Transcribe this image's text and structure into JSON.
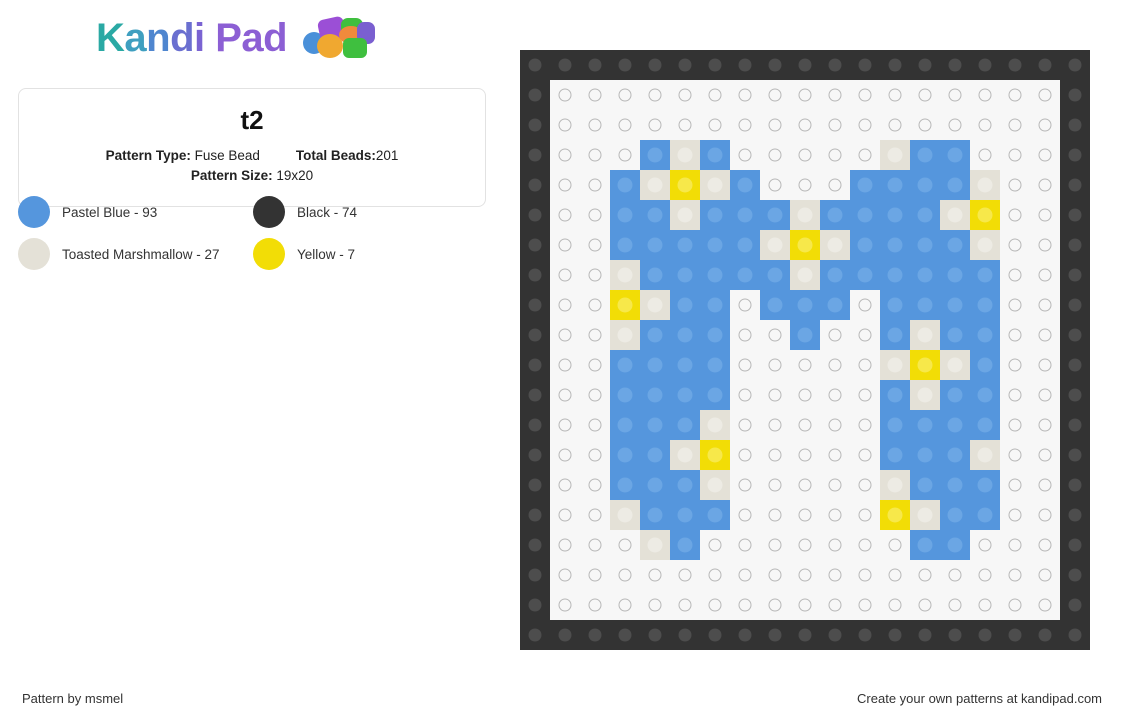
{
  "brand": {
    "name_parts": [
      "K",
      "a",
      "n",
      "d",
      "i",
      " Pad"
    ],
    "full_name": "Kandi Pad",
    "beads_icon": "kandi-beads-icon"
  },
  "pattern": {
    "title": "t2",
    "type_label": "Pattern Type:",
    "type_value": "Fuse Bead",
    "total_label": "Total Beads:",
    "total_value": "201",
    "size_label": "Pattern Size:",
    "size_value": "19x20"
  },
  "legend": [
    {
      "name": "Pastel Blue - 93",
      "color": "#5596dd",
      "swatch": "pastel-blue-swatch"
    },
    {
      "name": "Black - 74",
      "color": "#333333",
      "swatch": "black-swatch"
    },
    {
      "name": "Toasted Marshmallow - 27",
      "color": "#e4e1d7",
      "swatch": "toasted-marshmallow-swatch"
    },
    {
      "name": "Yellow - 7",
      "color": "#f2dd06",
      "swatch": "yellow-swatch"
    }
  ],
  "grid": {
    "columns": 19,
    "rows": 20,
    "legend_keys": {
      "k": "black",
      "b": "blue",
      "m": "marsh",
      "y": "yellow",
      ".": "empty"
    },
    "cells": [
      "kkkkkkkkkkkkkkkkkkk",
      "k.................k",
      "k.................k",
      "k...bmb.....mbb...k",
      "k..bmymb...bbbbm..k",
      "k..bbmbbbmbbbbmy..k",
      "k..bbbbbmymbbbbm..k",
      "k..mbbbbbmbbbbbb..k",
      "k..ymbb.bbb.bbbb..k",
      "k..mbbb..b..bmbb..k",
      "k..bbbb.....mymb..k",
      "k..bbbb.....bmbb..k",
      "k..bbbm.....bbbb..k",
      "k..bbmy.....bbbm..k",
      "k..bbbm.....mbbb..k",
      "k..mbbb.....ymbb..k",
      "k...mb.......bb...k",
      "k.................k",
      "k.................k",
      "kkkkkkkkkkkkkkkkkkk"
    ]
  },
  "footer": {
    "author": "Pattern by msmel",
    "promo": "Create your own patterns at kandipad.com"
  }
}
